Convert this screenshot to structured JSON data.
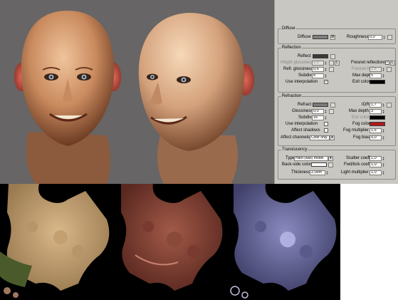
{
  "panel": {
    "diffuse": {
      "title": "Diffuse",
      "diffuse_label": "Diffuse",
      "diffuse_color": "#808080",
      "map_button": "M",
      "roughness_label": "Roughness",
      "roughness_value": "0,0"
    },
    "reflection": {
      "title": "Reflection",
      "reflect_label": "Reflect",
      "reflect_color": "#3a3a3a",
      "hilight_label": "Hilight glossiness",
      "hilight_value": "1,0",
      "lock_button": "L",
      "refl_gloss_label": "Refl. glossiness",
      "refl_gloss_value": "0,6",
      "subdivs_label": "Subdivs",
      "subdivs_value": "8",
      "use_interp_label": "Use interpolation",
      "use_interp_checked": "✓",
      "fresnel_label": "Fresnel reflections",
      "fresnel_checked": "✓",
      "fresnel_ior_label": "Fresnel IOR",
      "fresnel_ior_value": "1,6",
      "max_depth_label": "Max depth",
      "max_depth_value": "5",
      "exit_color_label": "Exit color",
      "exit_color": "#000000"
    },
    "refraction": {
      "title": "Refraction",
      "refract_label": "Refract",
      "refract_color": "#7a7a7a",
      "ior_label": "IOR",
      "ior_value": "1,7",
      "glossiness_label": "Glossiness",
      "glossiness_value": "0,0",
      "max_depth_label": "Max depth",
      "max_depth_value": "3",
      "subdivs_label": "Subdivs",
      "subdivs_value": "16",
      "exit_color_label": "Exit color",
      "exit_color": "#000000",
      "use_interp_label": "Use interpolation",
      "fog_color_label": "Fog color",
      "fog_color": "#b01a1a",
      "affect_shadows_label": "Affect shadows",
      "fog_mult_label": "Fog multiplier",
      "fog_mult_value": "1,6",
      "affect_channels_label": "Affect channels",
      "affect_channels_value": "Color only",
      "fog_bias_label": "Fog bias",
      "fog_bias_value": "0,0"
    },
    "translucency": {
      "title": "Translucency",
      "type_label": "Type",
      "type_value": "Hard (wax) model",
      "back_side_label": "Back-side color",
      "back_side_color": "#ffffff",
      "thickness_label": "Thickness",
      "thickness_value": "2,0cm",
      "scatter_label": "Scatter coeff",
      "scatter_value": "1,0",
      "fwd_bck_label": "Fwd/bck coeff",
      "fwd_bck_value": "1,0",
      "light_mult_label": "Light multiplier",
      "light_mult_value": "1,0"
    }
  },
  "colors": {
    "render_bg": "#676565",
    "panel_bg": "#c9c7c2",
    "skin": "#d9a27a",
    "map_bg": "#000000"
  }
}
